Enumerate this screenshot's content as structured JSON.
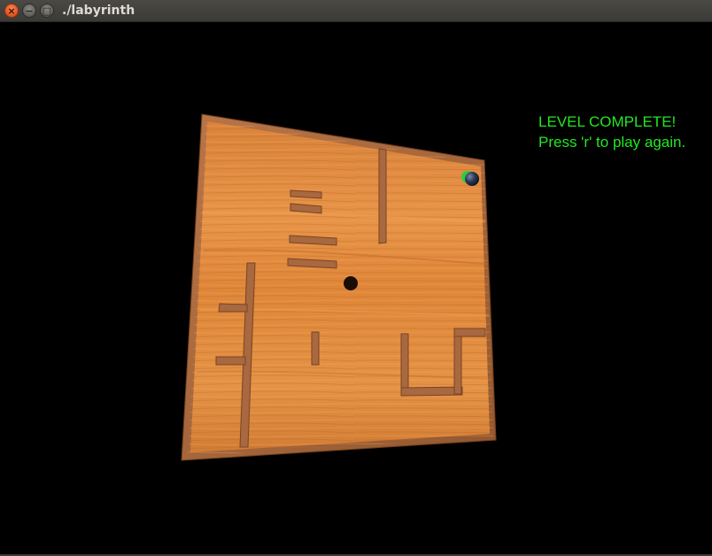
{
  "window": {
    "title": "./labyrinth",
    "close_glyph": "×",
    "minimize_glyph": "−",
    "maximize_glyph": "□"
  },
  "status": {
    "line1": "LEVEL COMPLETE!",
    "line2": "Press 'r' to play again.",
    "color": "#22e822"
  },
  "icons": {
    "close": "close-icon",
    "minimize": "minimize-icon",
    "maximize": "maximize-icon"
  },
  "colors": {
    "background": "#000000",
    "board_wood": "#e08a3c",
    "frame_wood": "#a4663a",
    "ball": "#2a3548",
    "goal": "#2ecc40",
    "hole": "#1a0d06"
  }
}
